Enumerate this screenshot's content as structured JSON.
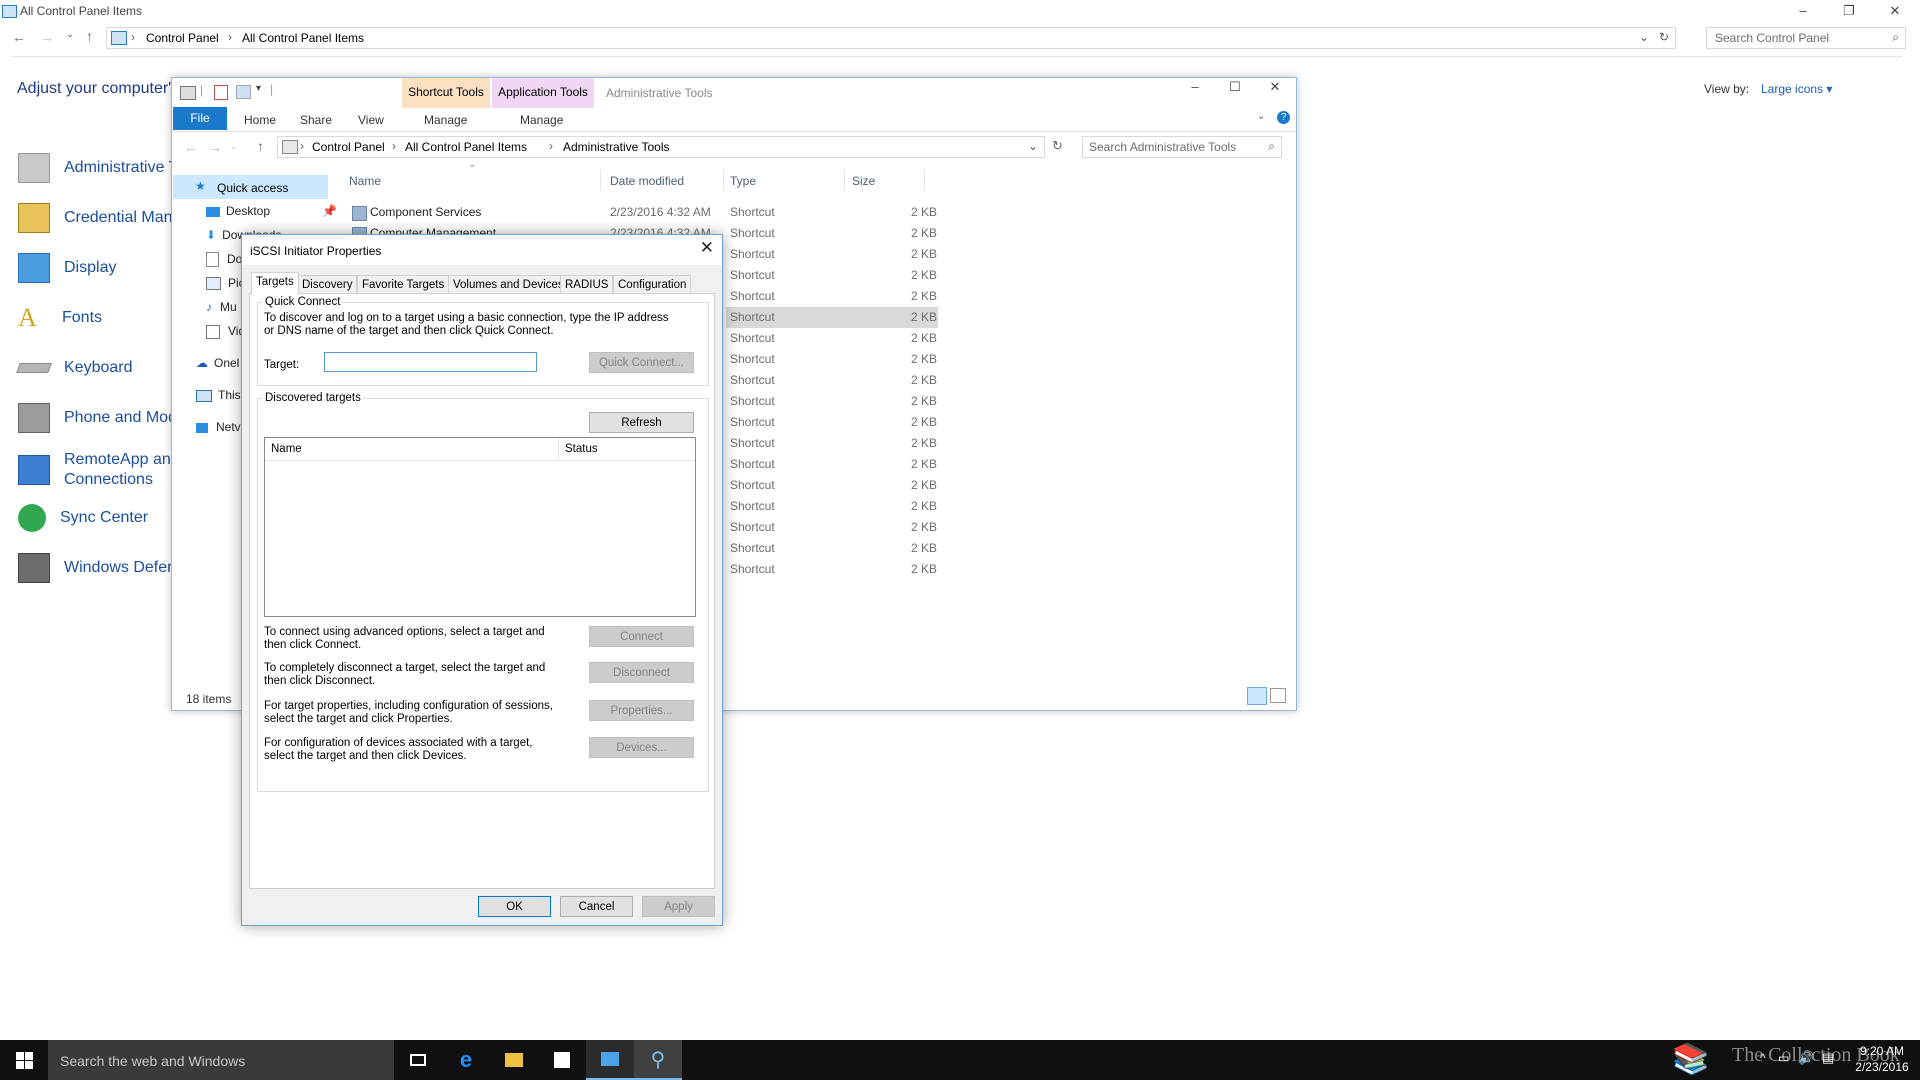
{
  "bg_window": {
    "title": "All Control Panel Items",
    "address": {
      "crumbs": [
        "Control Panel",
        "All Control Panel Items"
      ]
    },
    "search_placeholder": "Search Control Panel",
    "heading": "Adjust your computer's settings",
    "view_by_label": "View by:",
    "view_by_value": "Large icons ▾",
    "items": [
      {
        "label": "Administrative Tools",
        "icon": "administrative-tools-icon"
      },
      {
        "label": "Credential Manager",
        "icon": "credential-manager-icon"
      },
      {
        "label": "Display",
        "icon": "display-icon"
      },
      {
        "label": "Fonts",
        "icon": "fonts-icon"
      },
      {
        "label": "Keyboard",
        "icon": "keyboard-icon"
      },
      {
        "label": "Phone and Modem",
        "icon": "phone-modem-icon"
      },
      {
        "label": "RemoteApp and Desktop",
        "label2": "Connections",
        "icon": "remoteapp-icon"
      },
      {
        "label": "Sync Center",
        "icon": "sync-center-icon"
      },
      {
        "label": "Windows Defender",
        "icon": "windows-defender-icon"
      }
    ]
  },
  "explorer": {
    "context_tabs": [
      {
        "label": "Shortcut Tools",
        "sub": "Manage",
        "color": "#fbe0c2"
      },
      {
        "label": "Application Tools",
        "sub": "Manage",
        "color": "#f0d8f4"
      }
    ],
    "title": "Administrative Tools",
    "ribbon_tabs": [
      "File",
      "Home",
      "Share",
      "View"
    ],
    "address": {
      "crumbs": [
        "Control Panel",
        "All Control Panel Items",
        "Administrative Tools"
      ]
    },
    "search_placeholder": "Search Administrative Tools",
    "nav": {
      "quick_access": "Quick access",
      "items": [
        "Desktop",
        "Downloads",
        "Do",
        "Pic",
        "Mu",
        "Vid",
        "Onel",
        "This",
        "Netv"
      ]
    },
    "columns": {
      "name": "Name",
      "date": "Date modified",
      "type": "Type",
      "size": "Size"
    },
    "files": [
      {
        "name": "Component Services",
        "date": "2/23/2016 4:32 AM",
        "type": "Shortcut",
        "size": "2 KB"
      },
      {
        "name": "Computer Management",
        "date": "2/23/2016 4:32 AM",
        "type": "Shortcut",
        "size": "2 KB"
      },
      {
        "name": "",
        "date": "",
        "type": "Shortcut",
        "size": "2 KB"
      },
      {
        "name": "",
        "date": "",
        "type": "Shortcut",
        "size": "2 KB"
      },
      {
        "name": "",
        "date": "",
        "type": "Shortcut",
        "size": "2 KB"
      },
      {
        "name": "",
        "date": "",
        "type": "Shortcut",
        "size": "2 KB",
        "selected": true
      },
      {
        "name": "",
        "date": "",
        "type": "Shortcut",
        "size": "2 KB"
      },
      {
        "name": "",
        "date": "",
        "type": "Shortcut",
        "size": "2 KB"
      },
      {
        "name": "",
        "date": "",
        "type": "Shortcut",
        "size": "2 KB"
      },
      {
        "name": "",
        "date": "",
        "type": "Shortcut",
        "size": "2 KB"
      },
      {
        "name": "",
        "date": "",
        "type": "Shortcut",
        "size": "2 KB"
      },
      {
        "name": "",
        "date": "",
        "type": "Shortcut",
        "size": "2 KB"
      },
      {
        "name": "",
        "date": "",
        "type": "Shortcut",
        "size": "2 KB"
      },
      {
        "name": "",
        "date": "",
        "type": "Shortcut",
        "size": "2 KB"
      },
      {
        "name": "",
        "date": "",
        "type": "Shortcut",
        "size": "2 KB"
      },
      {
        "name": "",
        "date": "",
        "type": "Shortcut",
        "size": "2 KB"
      },
      {
        "name": "",
        "date": "",
        "type": "Shortcut",
        "size": "2 KB"
      },
      {
        "name": "",
        "date": "",
        "type": "Shortcut",
        "size": "2 KB"
      }
    ],
    "status": "18 items"
  },
  "dialog": {
    "title": "iSCSI Initiator Properties",
    "tabs": [
      "Targets",
      "Discovery",
      "Favorite Targets",
      "Volumes and Devices",
      "RADIUS",
      "Configuration"
    ],
    "quick_connect": {
      "legend": "Quick Connect",
      "description": "To discover and log on to a target using a basic connection, type the IP address or DNS name of the target and then click Quick Connect.",
      "target_label": "Target:",
      "target_value": "",
      "button": "Quick Connect..."
    },
    "discovered": {
      "legend": "Discovered targets",
      "refresh": "Refresh",
      "columns": [
        "Name",
        "Status"
      ]
    },
    "actions": [
      {
        "text": "To connect using advanced options, select a target and then click Connect.",
        "button": "Connect"
      },
      {
        "text": "To completely disconnect a target, select the target and then click Disconnect.",
        "button": "Disconnect"
      },
      {
        "text": "For target properties, including configuration of sessions, select the target and click Properties.",
        "button": "Properties..."
      },
      {
        "text": "For configuration of devices associated with a target, select the target and then click Devices.",
        "button": "Devices..."
      }
    ],
    "footer": {
      "ok": "OK",
      "cancel": "Cancel",
      "apply": "Apply"
    }
  },
  "taskbar": {
    "search_placeholder": "Search the web and Windows",
    "watermark": "The Collection Book",
    "time": "9:20 AM",
    "date": "2/23/2016"
  }
}
